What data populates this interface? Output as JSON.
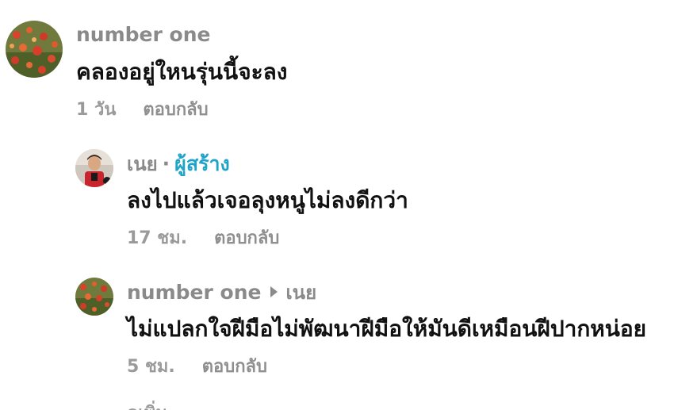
{
  "comments": [
    {
      "author": "number one",
      "text": "คลองอยู่ใหนรุ่นนี้จะลง",
      "time": "1 วัน",
      "reply_label": "ตอบกลับ",
      "avatar": "flower-field-avatar"
    },
    {
      "author": "เนย",
      "creator_sep": "·",
      "creator_label": "ผู้สร้าง",
      "text": "ลงไปแล้วเจอลุงหนูไม่ลงดีกว่า",
      "time": "17 ชม.",
      "reply_label": "ตอบกลับ",
      "avatar": "player-avatar"
    },
    {
      "author": "number one",
      "reply_to": "เนย",
      "text": "ไม่แปลกใจฝีมือไม่พัฒนาฝีมือให้มันดีเหมือนฝีปากหน่อย",
      "time": "5 ชม.",
      "reply_label": "ตอบกลับ",
      "avatar": "flower-field-avatar"
    }
  ],
  "more_label": "ดูเพิ่ม",
  "colors": {
    "author": "#8a8a8a",
    "creator": "#1fa3c9",
    "text": "#111111",
    "meta": "#9a9a9a"
  }
}
